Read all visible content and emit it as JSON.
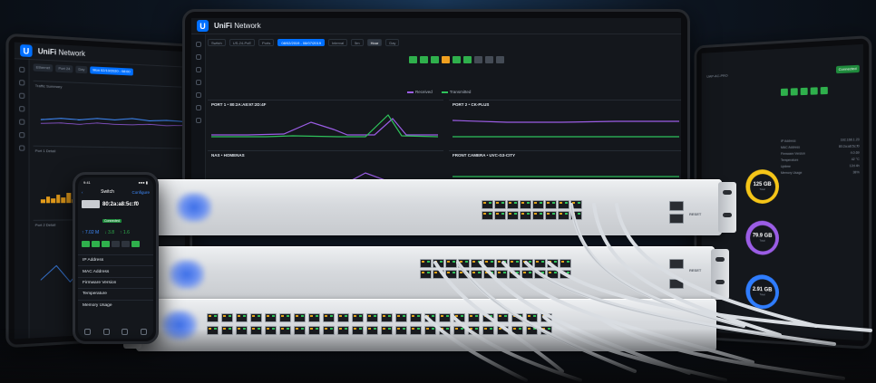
{
  "brand": {
    "logo_letter": "U",
    "name_prefix": "UniFi",
    "name_suffix": "Network"
  },
  "left_tablet": {
    "toolbar": [
      "Ethernet",
      "Port 24",
      "Day",
      "Mon 02/10/2020 - 08:00"
    ],
    "panel_labels": [
      "Traffic Summary",
      "Port 1 Detail",
      "Port 2 Detail"
    ]
  },
  "center_tablet": {
    "toolbar": [
      "Switch",
      "US-24-PoE",
      "Ports",
      "08/02/2019 - 08/07/2019",
      "Interval",
      "5m",
      "Hour",
      "Day"
    ],
    "legend": [
      {
        "label": "Received",
        "color": "#9b5de5"
      },
      {
        "label": "Transmitted",
        "color": "#2fc25b"
      }
    ],
    "swatch_colors": [
      "#2fb04c",
      "#2fb04c",
      "#2fb04c",
      "#f0a020",
      "#2fb04c",
      "#2fb04c",
      "#444b55",
      "#444b55",
      "#444b55"
    ],
    "charts": [
      {
        "title": "PORT 1  •  80:2A:A8:97:2D:4F"
      },
      {
        "title": "PORT 2  •  CK-PLUS"
      },
      {
        "title": "NAS  •  HOMENAS"
      },
      {
        "title": "FRONT CAMERA  •  UVC-G3-CITY"
      }
    ]
  },
  "right_tablet": {
    "header_left": "UAP-AC-PRO",
    "header_right": "Connected",
    "props": [
      [
        "IP Address",
        "192.168.1.23"
      ],
      [
        "MAC Address",
        "80:2a:a8:5c:f0"
      ],
      [
        "Firmware Version",
        "4.0.69"
      ],
      [
        "Temperature",
        "42 °C"
      ],
      [
        "Uptime",
        "12d 4h"
      ],
      [
        "Memory Usage",
        "38%"
      ]
    ],
    "donuts": [
      {
        "value": "125 GB",
        "sub": "Total",
        "color": "#f5c518"
      },
      {
        "value": "79.9 GB",
        "sub": "Total",
        "color": "#9b5de5"
      },
      {
        "value": "2.91 GB",
        "sub": "Total",
        "color": "#2f7dff"
      }
    ]
  },
  "phone": {
    "time": "9:41",
    "signal": "●●● ▮",
    "back": "‹",
    "title": "Switch",
    "configure": "Configure",
    "device_name": "80:2a:a8:5c:f0",
    "status": "Connected",
    "metrics": [
      "↑ 7.02 M",
      "↓ 3.8",
      "↑ 1.6"
    ],
    "list": [
      "IP Address",
      "MAC Address",
      "Firmware Version",
      "Temperature",
      "Memory Usage"
    ]
  },
  "switches": {
    "reset_label": "RESET",
    "top_port_labels": [
      "1",
      "3",
      "5",
      "7",
      "9",
      "11",
      "13",
      "15"
    ],
    "mid_port_labels": [
      "1",
      "3",
      "5",
      "7",
      "9",
      "11",
      "13",
      "15",
      "17",
      "19",
      "21",
      "23"
    ],
    "bottom_port_labels": [
      "1",
      "3",
      "5",
      "7",
      "9",
      "11",
      "13",
      "15",
      "17",
      "19",
      "21",
      "23",
      "25",
      "27",
      "29",
      "31",
      "33",
      "35",
      "37",
      "39",
      "41",
      "43",
      "45",
      "47"
    ]
  }
}
